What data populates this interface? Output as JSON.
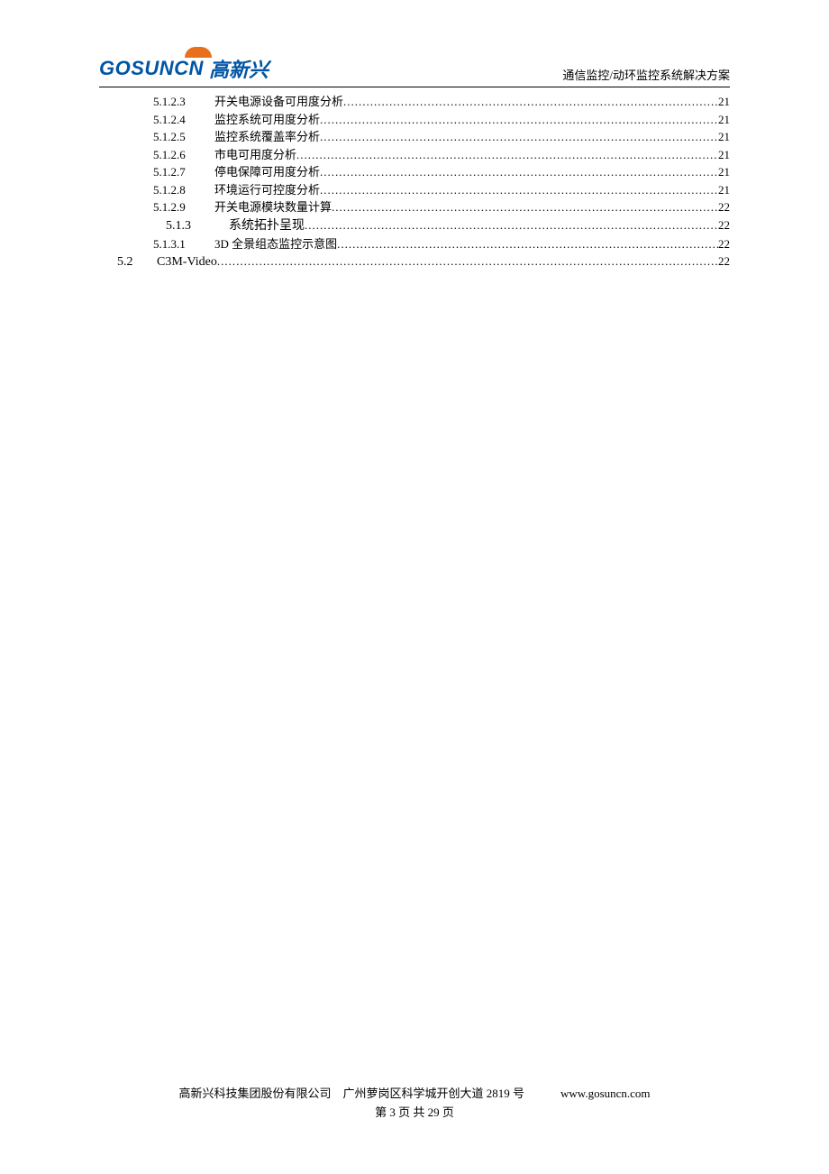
{
  "header": {
    "logo_en": "GOSUNCN",
    "logo_cn": "高新兴",
    "doc_title": "通信监控/动环监控系统解决方案"
  },
  "toc": [
    {
      "level": 4,
      "num": "5.1.2.3",
      "title": "开关电源设备可用度分析",
      "page": "21"
    },
    {
      "level": 4,
      "num": "5.1.2.4",
      "title": "监控系统可用度分析",
      "page": "21"
    },
    {
      "level": 4,
      "num": "5.1.2.5",
      "title": "监控系统覆盖率分析",
      "page": "21"
    },
    {
      "level": 4,
      "num": "5.1.2.6",
      "title": "市电可用度分析",
      "page": "21"
    },
    {
      "level": 4,
      "num": "5.1.2.7",
      "title": "停电保障可用度分析",
      "page": "21"
    },
    {
      "level": 4,
      "num": "5.1.2.8",
      "title": "环境运行可控度分析",
      "page": "21"
    },
    {
      "level": 4,
      "num": "5.1.2.9",
      "title": "开关电源模块数量计算",
      "page": "22"
    },
    {
      "level": 3,
      "num": "5.1.3",
      "title": "系统拓扑呈现",
      "page": "22"
    },
    {
      "level": 4,
      "num": "5.1.3.1",
      "title": "3D 全景组态监控示意图",
      "page": "22"
    },
    {
      "level": 2,
      "num": "5.2",
      "title": "C3M-Video",
      "page": "22"
    }
  ],
  "footer": {
    "company": "高新兴科技集团股份有限公司",
    "address": "广州萝岗区科学城开创大道 2819 号",
    "url": "www.gosuncn.com",
    "pagenum": "第 3 页  共 29 页"
  }
}
